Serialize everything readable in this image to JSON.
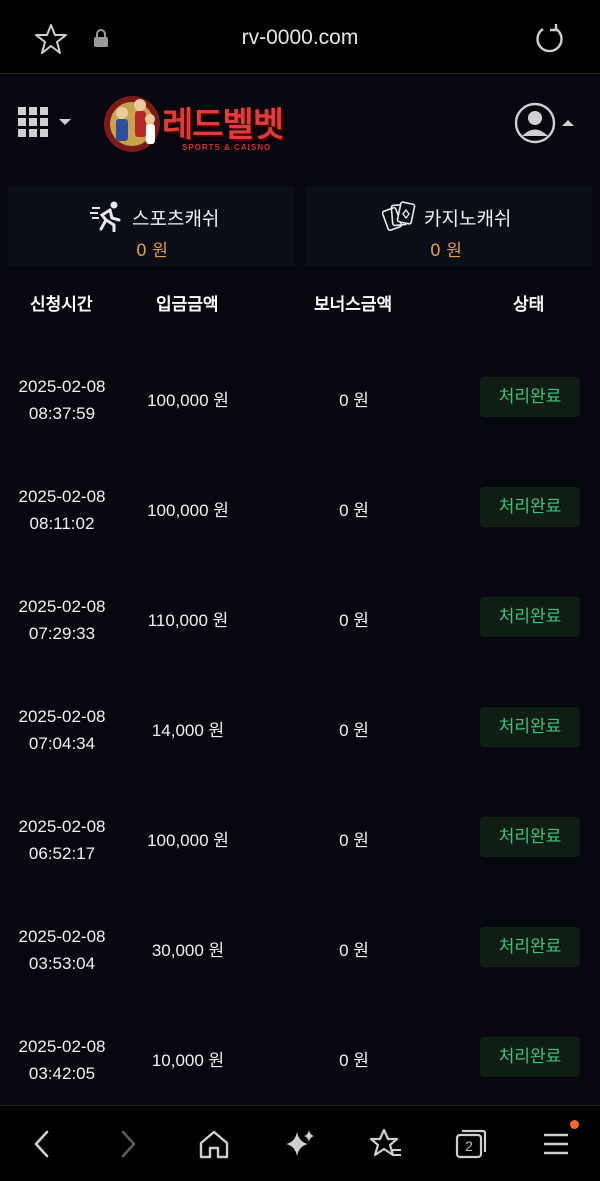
{
  "browser": {
    "url": "rv-0000.com",
    "tabs_count": "2"
  },
  "site": {
    "logo_text": "레드벨벳",
    "logo_sub": "SPORTS & CAISNO"
  },
  "cards": {
    "sports": {
      "label": "스포츠캐쉬",
      "amount": "0 원"
    },
    "casino": {
      "label": "카지노캐쉬",
      "amount": "0 원"
    }
  },
  "table": {
    "headers": [
      "신청시간",
      "입금금액",
      "보너스금액",
      "상태"
    ],
    "rows": [
      {
        "date": "2025-02-08",
        "time": "08:37:59",
        "amount": "100,000 원",
        "bonus": "0 원",
        "status": "처리완료"
      },
      {
        "date": "2025-02-08",
        "time": "08:11:02",
        "amount": "100,000 원",
        "bonus": "0 원",
        "status": "처리완료"
      },
      {
        "date": "2025-02-08",
        "time": "07:29:33",
        "amount": "110,000 원",
        "bonus": "0 원",
        "status": "처리완료"
      },
      {
        "date": "2025-02-08",
        "time": "07:04:34",
        "amount": "14,000 원",
        "bonus": "0 원",
        "status": "처리완료"
      },
      {
        "date": "2025-02-08",
        "time": "06:52:17",
        "amount": "100,000 원",
        "bonus": "0 원",
        "status": "처리완료"
      },
      {
        "date": "2025-02-08",
        "time": "03:53:04",
        "amount": "30,000 원",
        "bonus": "0 원",
        "status": "처리완료"
      },
      {
        "date": "2025-02-08",
        "time": "03:42:05",
        "amount": "10,000 원",
        "bonus": "0 원",
        "status": "처리완료"
      }
    ]
  },
  "colors": {
    "background": "#07080f",
    "accent_amount": "#d9a04a",
    "status_text": "#3fc27a",
    "logo_red": "#e23b3b"
  }
}
